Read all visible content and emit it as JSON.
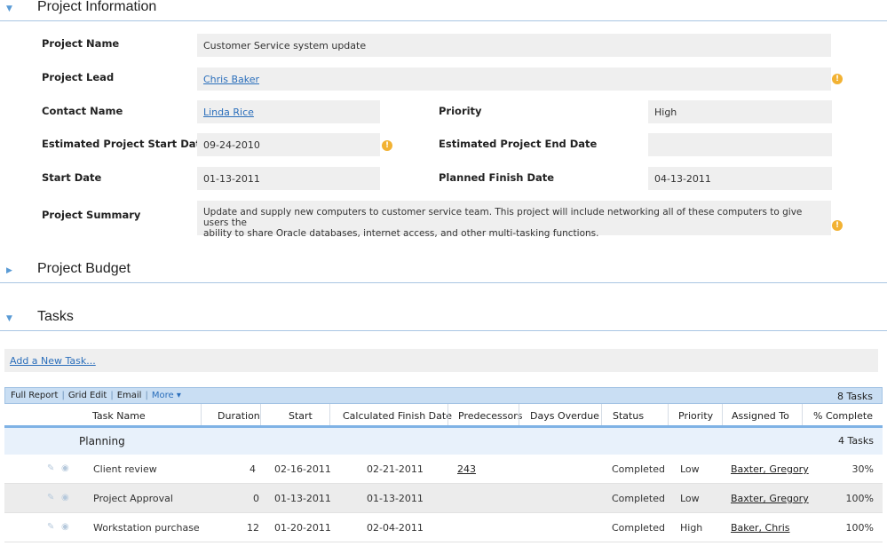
{
  "sections": {
    "info": {
      "toggle": "▼",
      "title": "Project Information"
    },
    "budget": {
      "toggle": "▶",
      "title": "Project Budget"
    },
    "tasks": {
      "toggle": "▼",
      "title": "Tasks"
    }
  },
  "fields": {
    "project_name": {
      "label": "Project Name",
      "value": "Customer Service system update"
    },
    "project_lead": {
      "label": "Project Lead",
      "value": "Chris Baker"
    },
    "contact_name": {
      "label": "Contact Name",
      "value": "Linda Rice"
    },
    "priority": {
      "label": "Priority",
      "value": "High"
    },
    "est_start": {
      "label": "Estimated Project Start Date",
      "value": "09-24-2010"
    },
    "est_end": {
      "label": "Estimated Project End Date",
      "value": ""
    },
    "start_date": {
      "label": "Start Date",
      "value": "01-13-2011"
    },
    "planned_finish": {
      "label": "Planned Finish Date",
      "value": "04-13-2011"
    },
    "summary": {
      "label": "Project Summary",
      "value_line1": "Update and supply new computers to customer service team.  This project will include networking all of these computers to give users the",
      "value_line2": "ability to share Oracle databases, internet access, and other multi-tasking functions."
    }
  },
  "help_icon_glyph": "!",
  "add_task_label": "Add a New Task...",
  "toolbar": {
    "full_report": "Full Report",
    "grid_edit": "Grid Edit",
    "email": "Email",
    "more": "More ▾",
    "sep": "|",
    "task_count": "8 Tasks"
  },
  "columns": [
    "Task Name",
    "Duration",
    "Start",
    "Calculated Finish Date",
    "Predecessors",
    "Days Overdue",
    "Status",
    "Priority",
    "Assigned To",
    "% Complete"
  ],
  "group": {
    "name": "Planning",
    "count": "4 Tasks"
  },
  "icons": {
    "edit": "✎",
    "view": "◉"
  },
  "rows": [
    {
      "name": "Client review",
      "duration": "4",
      "start": "02-16-2011",
      "finish": "02-21-2011",
      "pred": "243",
      "overdue": "",
      "status": "Completed",
      "priority": "Low",
      "assigned": "Baxter, Gregory",
      "pct": "30%"
    },
    {
      "name": "Project Approval",
      "duration": "0",
      "start": "01-13-2011",
      "finish": "01-13-2011",
      "pred": "",
      "overdue": "",
      "status": "Completed",
      "priority": "Low",
      "assigned": "Baxter, Gregory",
      "pct": "100%"
    },
    {
      "name": "Workstation purchase",
      "duration": "12",
      "start": "01-20-2011",
      "finish": "02-04-2011",
      "pred": "",
      "overdue": "",
      "status": "Completed",
      "priority": "High",
      "assigned": "Baker, Chris",
      "pct": "100%"
    }
  ],
  "colors": {
    "accent": "#2a6ebb",
    "help": "#f2b233",
    "toolbar": "#c9def3",
    "group_bg": "#e8f1fb"
  }
}
